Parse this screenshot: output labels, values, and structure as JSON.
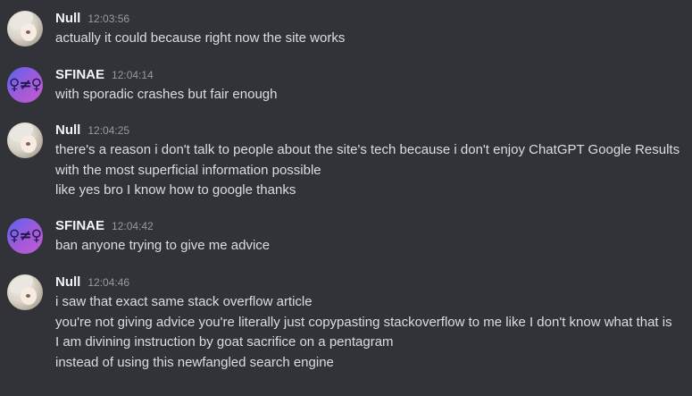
{
  "messages": [
    {
      "author": "Null",
      "time": "12:03:56",
      "avatar": "null-avatar",
      "lines": [
        "actually it could because right now the site works"
      ]
    },
    {
      "author": "SFINAE",
      "time": "12:04:14",
      "avatar": "sfinae-avatar",
      "avatar_glyph": "♀≠♀",
      "lines": [
        "with sporadic crashes but fair enough"
      ]
    },
    {
      "author": "Null",
      "time": "12:04:25",
      "avatar": "null-avatar",
      "lines": [
        "there's a reason i don't talk to people about the site's tech because i don't enjoy ChatGPT Google Results with the most superficial information possible",
        "like yes bro I know how to google thanks"
      ]
    },
    {
      "author": "SFINAE",
      "time": "12:04:42",
      "avatar": "sfinae-avatar",
      "avatar_glyph": "♀≠♀",
      "lines": [
        "ban anyone trying to give me advice"
      ]
    },
    {
      "author": "Null",
      "time": "12:04:46",
      "avatar": "null-avatar",
      "lines": [
        "i saw that exact same stack overflow article",
        "you're not giving advice you're literally just copypasting stackoverflow to me like I don't know what that is",
        "I am divining instruction by goat sacrifice on a pentagram",
        "instead of using this newfangled search engine"
      ]
    }
  ],
  "colors": {
    "background": "#313338",
    "username": "#f2f3f5",
    "text": "#dbdee1",
    "timestamp": "#949ba4"
  }
}
